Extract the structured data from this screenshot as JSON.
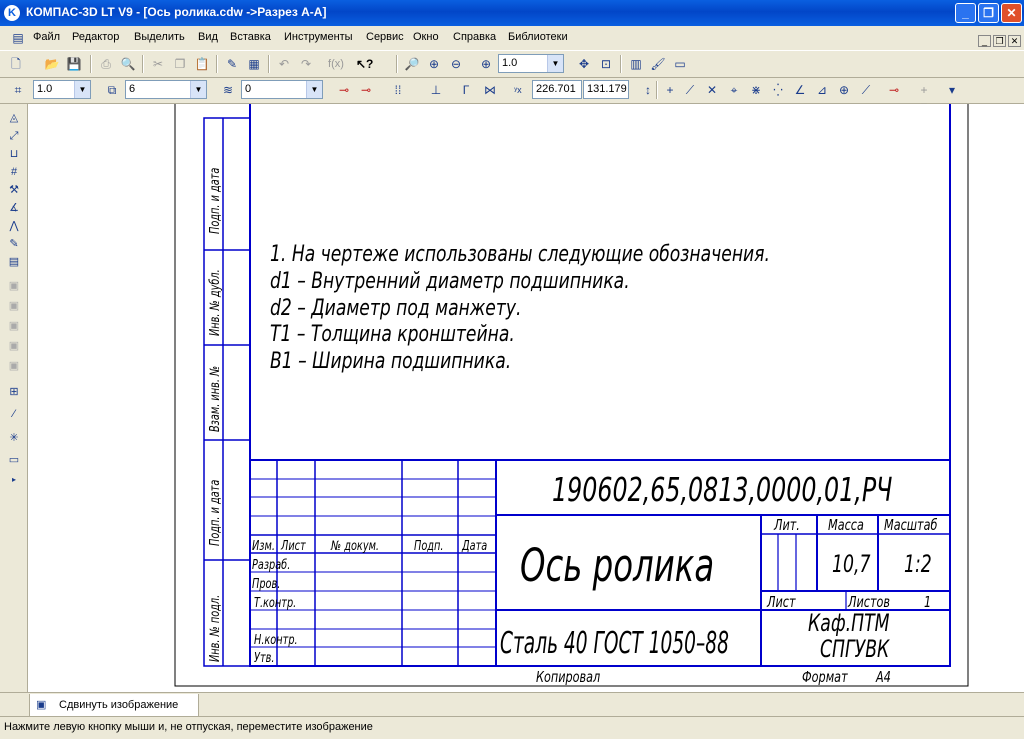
{
  "window": {
    "title": "КОМПАС-3D LT V9 - [Ось ролика.cdw ->Разрез А-А]",
    "logo": "K",
    "buttons": [
      "_",
      "❐",
      "✕"
    ]
  },
  "menu": {
    "items": [
      "Файл",
      "Редактор",
      "Выделить",
      "Вид",
      "Вставка",
      "Инструменты",
      "Сервис",
      "Окно",
      "Справка",
      "Библиотеки"
    ],
    "mdi_buttons": [
      "_",
      "❐",
      "✕"
    ]
  },
  "toolbar1": {
    "zoom_value": "1.0",
    "icons": [
      "new-icon",
      "open-icon",
      "save-icon",
      "print-icon",
      "preview-icon",
      "cut-icon",
      "copy-icon",
      "paste-icon",
      "properties-icon",
      "undo-icon",
      "redo-icon",
      "formula-icon",
      "help-pointer-icon",
      "zoom-window-icon",
      "zoom-in-icon",
      "zoom-out-icon",
      "zoom-scale-icon",
      "pan-icon",
      "fit-icon",
      "layers-icon",
      "manager-icon",
      "views-icon"
    ]
  },
  "toolbar2": {
    "step": "1.0",
    "layer": "6",
    "style": "0",
    "coord_x": "226.701",
    "coord_y": "131.179"
  },
  "status": {
    "tab_label": "Сдвинуть изображение",
    "hint": "Нажмите левую кнопку мыши и, не отпуская, переместите изображение"
  },
  "drawing": {
    "notes": [
      "1. На чертеже использованы следующие обозначения.",
      "d1 – Внутренний диаметр подшипника.",
      "d2 – Диаметр под манжету.",
      "Т1 – Толщина кронштейна.",
      "В1 – Ширина подшипника."
    ],
    "side_labels": [
      "Подп. и дата",
      "Инв. № дубл.",
      "Взам. инв. №",
      "Подп. и дата",
      "Инв. № подл."
    ],
    "designation": "190602,65,0813,0000,01,РЧ",
    "part_name": "Ось ролика",
    "material": "Сталь 40  ГОСТ 1050–88",
    "org_line1": "Каф.ПТМ",
    "org_line2": "СПГУВК",
    "header_izm": "Изм.",
    "header_list": "Лист",
    "header_doc": "№ докум.",
    "header_sign": "Подп.",
    "header_date": "Дата",
    "row_razrab": "Разраб.",
    "row_prov": "Пров.",
    "row_tkontr": "Т.контр.",
    "row_nkontr": "Н.контр.",
    "row_utv": "Утв.",
    "lit_label": "Лит.",
    "mass_label": "Масса",
    "scale_label": "Масштаб",
    "mass": "10,7",
    "scale": "1:2",
    "sheet_label": "Лист",
    "sheets_label": "Листов",
    "sheets": "1",
    "copied": "Копировал",
    "format_label": "Формат",
    "format": "А4"
  }
}
